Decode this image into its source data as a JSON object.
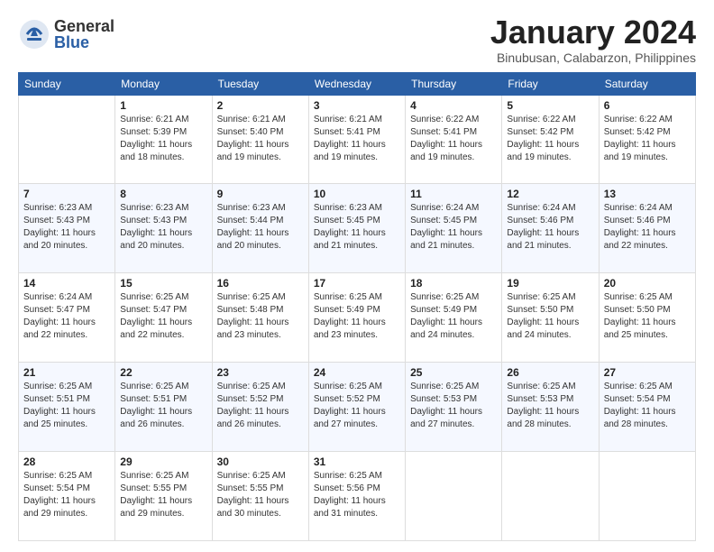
{
  "logo": {
    "general": "General",
    "blue": "Blue"
  },
  "header": {
    "title": "January 2024",
    "subtitle": "Binubusan, Calabarzon, Philippines"
  },
  "days_of_week": [
    "Sunday",
    "Monday",
    "Tuesday",
    "Wednesday",
    "Thursday",
    "Friday",
    "Saturday"
  ],
  "weeks": [
    [
      {
        "day": "",
        "sunrise": "",
        "sunset": "",
        "daylight": "",
        "empty": true
      },
      {
        "day": "1",
        "sunrise": "Sunrise: 6:21 AM",
        "sunset": "Sunset: 5:39 PM",
        "daylight": "Daylight: 11 hours and 18 minutes."
      },
      {
        "day": "2",
        "sunrise": "Sunrise: 6:21 AM",
        "sunset": "Sunset: 5:40 PM",
        "daylight": "Daylight: 11 hours and 19 minutes."
      },
      {
        "day": "3",
        "sunrise": "Sunrise: 6:21 AM",
        "sunset": "Sunset: 5:41 PM",
        "daylight": "Daylight: 11 hours and 19 minutes."
      },
      {
        "day": "4",
        "sunrise": "Sunrise: 6:22 AM",
        "sunset": "Sunset: 5:41 PM",
        "daylight": "Daylight: 11 hours and 19 minutes."
      },
      {
        "day": "5",
        "sunrise": "Sunrise: 6:22 AM",
        "sunset": "Sunset: 5:42 PM",
        "daylight": "Daylight: 11 hours and 19 minutes."
      },
      {
        "day": "6",
        "sunrise": "Sunrise: 6:22 AM",
        "sunset": "Sunset: 5:42 PM",
        "daylight": "Daylight: 11 hours and 19 minutes."
      }
    ],
    [
      {
        "day": "7",
        "sunrise": "Sunrise: 6:23 AM",
        "sunset": "Sunset: 5:43 PM",
        "daylight": "Daylight: 11 hours and 20 minutes."
      },
      {
        "day": "8",
        "sunrise": "Sunrise: 6:23 AM",
        "sunset": "Sunset: 5:43 PM",
        "daylight": "Daylight: 11 hours and 20 minutes."
      },
      {
        "day": "9",
        "sunrise": "Sunrise: 6:23 AM",
        "sunset": "Sunset: 5:44 PM",
        "daylight": "Daylight: 11 hours and 20 minutes."
      },
      {
        "day": "10",
        "sunrise": "Sunrise: 6:23 AM",
        "sunset": "Sunset: 5:45 PM",
        "daylight": "Daylight: 11 hours and 21 minutes."
      },
      {
        "day": "11",
        "sunrise": "Sunrise: 6:24 AM",
        "sunset": "Sunset: 5:45 PM",
        "daylight": "Daylight: 11 hours and 21 minutes."
      },
      {
        "day": "12",
        "sunrise": "Sunrise: 6:24 AM",
        "sunset": "Sunset: 5:46 PM",
        "daylight": "Daylight: 11 hours and 21 minutes."
      },
      {
        "day": "13",
        "sunrise": "Sunrise: 6:24 AM",
        "sunset": "Sunset: 5:46 PM",
        "daylight": "Daylight: 11 hours and 22 minutes."
      }
    ],
    [
      {
        "day": "14",
        "sunrise": "Sunrise: 6:24 AM",
        "sunset": "Sunset: 5:47 PM",
        "daylight": "Daylight: 11 hours and 22 minutes."
      },
      {
        "day": "15",
        "sunrise": "Sunrise: 6:25 AM",
        "sunset": "Sunset: 5:47 PM",
        "daylight": "Daylight: 11 hours and 22 minutes."
      },
      {
        "day": "16",
        "sunrise": "Sunrise: 6:25 AM",
        "sunset": "Sunset: 5:48 PM",
        "daylight": "Daylight: 11 hours and 23 minutes."
      },
      {
        "day": "17",
        "sunrise": "Sunrise: 6:25 AM",
        "sunset": "Sunset: 5:49 PM",
        "daylight": "Daylight: 11 hours and 23 minutes."
      },
      {
        "day": "18",
        "sunrise": "Sunrise: 6:25 AM",
        "sunset": "Sunset: 5:49 PM",
        "daylight": "Daylight: 11 hours and 24 minutes."
      },
      {
        "day": "19",
        "sunrise": "Sunrise: 6:25 AM",
        "sunset": "Sunset: 5:50 PM",
        "daylight": "Daylight: 11 hours and 24 minutes."
      },
      {
        "day": "20",
        "sunrise": "Sunrise: 6:25 AM",
        "sunset": "Sunset: 5:50 PM",
        "daylight": "Daylight: 11 hours and 25 minutes."
      }
    ],
    [
      {
        "day": "21",
        "sunrise": "Sunrise: 6:25 AM",
        "sunset": "Sunset: 5:51 PM",
        "daylight": "Daylight: 11 hours and 25 minutes."
      },
      {
        "day": "22",
        "sunrise": "Sunrise: 6:25 AM",
        "sunset": "Sunset: 5:51 PM",
        "daylight": "Daylight: 11 hours and 26 minutes."
      },
      {
        "day": "23",
        "sunrise": "Sunrise: 6:25 AM",
        "sunset": "Sunset: 5:52 PM",
        "daylight": "Daylight: 11 hours and 26 minutes."
      },
      {
        "day": "24",
        "sunrise": "Sunrise: 6:25 AM",
        "sunset": "Sunset: 5:52 PM",
        "daylight": "Daylight: 11 hours and 27 minutes."
      },
      {
        "day": "25",
        "sunrise": "Sunrise: 6:25 AM",
        "sunset": "Sunset: 5:53 PM",
        "daylight": "Daylight: 11 hours and 27 minutes."
      },
      {
        "day": "26",
        "sunrise": "Sunrise: 6:25 AM",
        "sunset": "Sunset: 5:53 PM",
        "daylight": "Daylight: 11 hours and 28 minutes."
      },
      {
        "day": "27",
        "sunrise": "Sunrise: 6:25 AM",
        "sunset": "Sunset: 5:54 PM",
        "daylight": "Daylight: 11 hours and 28 minutes."
      }
    ],
    [
      {
        "day": "28",
        "sunrise": "Sunrise: 6:25 AM",
        "sunset": "Sunset: 5:54 PM",
        "daylight": "Daylight: 11 hours and 29 minutes."
      },
      {
        "day": "29",
        "sunrise": "Sunrise: 6:25 AM",
        "sunset": "Sunset: 5:55 PM",
        "daylight": "Daylight: 11 hours and 29 minutes."
      },
      {
        "day": "30",
        "sunrise": "Sunrise: 6:25 AM",
        "sunset": "Sunset: 5:55 PM",
        "daylight": "Daylight: 11 hours and 30 minutes."
      },
      {
        "day": "31",
        "sunrise": "Sunrise: 6:25 AM",
        "sunset": "Sunset: 5:56 PM",
        "daylight": "Daylight: 11 hours and 31 minutes."
      },
      {
        "day": "",
        "sunrise": "",
        "sunset": "",
        "daylight": "",
        "empty": true
      },
      {
        "day": "",
        "sunrise": "",
        "sunset": "",
        "daylight": "",
        "empty": true
      },
      {
        "day": "",
        "sunrise": "",
        "sunset": "",
        "daylight": "",
        "empty": true
      }
    ]
  ]
}
